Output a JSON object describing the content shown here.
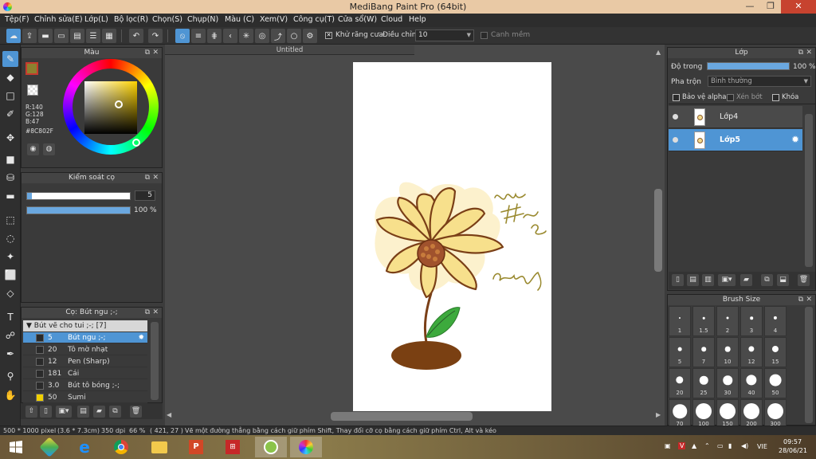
{
  "window": {
    "title": "MediBang Paint Pro (64bit)",
    "controls": {
      "minimize": "—",
      "restore": "❐",
      "close": "✕"
    }
  },
  "menu": [
    "Tệp(F)",
    "Chỉnh sửa(E)",
    "Lớp(L)",
    "Bộ lọc(R)",
    "Chọn(S)",
    "Chụp(N)",
    "Màu (C)",
    "Xem(V)",
    "Công cụ(T)",
    "Cửa sổ(W)",
    "Cloud",
    "Help"
  ],
  "toolbar": {
    "antialias_label": "Khử răng cưa",
    "antialias_checked": "✕",
    "correction_label": "Điều chỉnh",
    "correction_value": "10",
    "snap_label": "Canh mềm"
  },
  "color_panel": {
    "title": "Màu",
    "r": "R:140",
    "g": "G:128",
    "b": "B:47",
    "hex": "#8C802F",
    "fg_color": "#8c802f",
    "bg_color": "#6aa7df"
  },
  "brush_control": {
    "title": "Kiểm soát cọ",
    "size": "5",
    "size_fraction": 0.05,
    "opacity": "100 %",
    "opacity_fraction": 1.0
  },
  "brush_panel": {
    "title": "Cọ: Bút ngu ;-;",
    "group": "Bút vẽ cho tui ;-; [7]",
    "items": [
      {
        "size": "5",
        "name": "Bút ngu ;-;",
        "color": "#2a2a2a",
        "active": true
      },
      {
        "size": "20",
        "name": "Tô mờ nhạt",
        "color": "#2a2a2a",
        "active": false
      },
      {
        "size": "12",
        "name": "Pen (Sharp)",
        "color": "#2a2a2a",
        "active": false
      },
      {
        "size": "181",
        "name": "Cái",
        "color": "#2a2a2a",
        "active": false
      },
      {
        "size": "3.0",
        "name": "Bút tô bóng ;-;",
        "color": "#2a2a2a",
        "active": false
      },
      {
        "size": "50",
        "name": "Sumi",
        "color": "#f0d000",
        "active": false
      }
    ]
  },
  "document": {
    "tab": "Untitled",
    "signature_text": "dung #Hè Mạt 2k7 chuyện"
  },
  "layer_panel": {
    "title": "Lớp",
    "opacity_label": "Độ trong",
    "opacity_value": "100 %",
    "blend_label": "Pha trộn",
    "blend_value": "Bình thường",
    "protect_alpha": "Bảo vệ alpha",
    "clipping": "Xén bớt",
    "lock": "Khóa",
    "layers": [
      {
        "name": "Lớp4",
        "active": false
      },
      {
        "name": "Lớp5",
        "active": true
      }
    ]
  },
  "brush_size_panel": {
    "title": "Brush Size",
    "sizes": [
      "1",
      "1.5",
      "2",
      "3",
      "4",
      "5",
      "7",
      "10",
      "12",
      "15",
      "20",
      "25",
      "30",
      "40",
      "50",
      "70",
      "100",
      "150",
      "200",
      "300"
    ]
  },
  "status": {
    "dimensions": "500 * 1000 pixel",
    "physical": "(3.6 * 7.3cm)",
    "dpi": "350 dpi",
    "zoom": "66 %",
    "cursor": "( 421, 27 )",
    "hint": "Vẽ một đường thẳng bằng cách giữ phím Shift, Thay đổi cỡ cọ bằng cách giữ phím Ctrl, Alt và kéo"
  },
  "taskbar": {
    "lang": "VIE",
    "time": "09:57",
    "date": "28/06/21"
  }
}
